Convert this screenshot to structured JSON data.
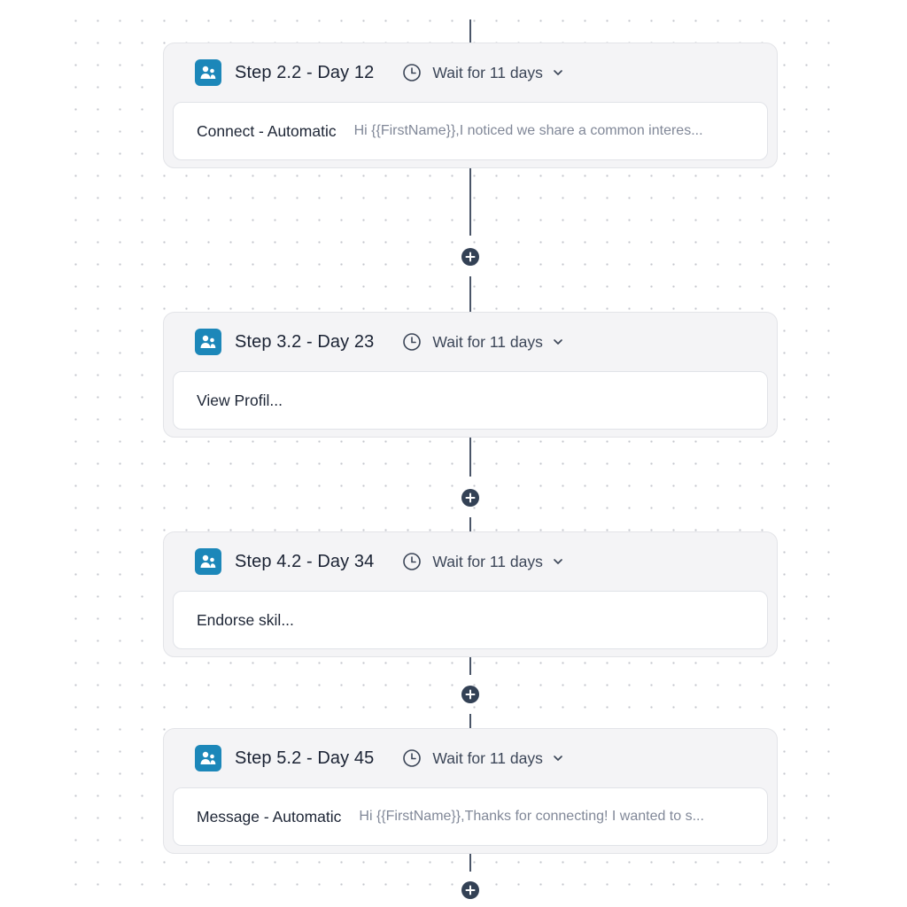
{
  "canvas": {
    "connector_color": "#4a5568",
    "add_button_color": "#334155",
    "step_icon_color": "#1c87b9"
  },
  "steps": [
    {
      "title": "Step 2.2 - Day 12",
      "icon": "people-icon",
      "wait_label": "Wait for 11 days",
      "action": "Connect - Automatic",
      "preview": "Hi {{FirstName}},I noticed we share a common interes..."
    },
    {
      "title": "Step 3.2 - Day 23",
      "icon": "people-icon",
      "wait_label": "Wait for 11 days",
      "action": "View Profil...",
      "preview": ""
    },
    {
      "title": "Step 4.2 - Day 34",
      "icon": "people-icon",
      "wait_label": "Wait for 11 days",
      "action": "Endorse skil...",
      "preview": ""
    },
    {
      "title": "Step 5.2 - Day 45",
      "icon": "people-icon",
      "wait_label": "Wait for 11 days",
      "action": "Message - Automatic",
      "preview": "Hi {{FirstName}},Thanks for connecting! I wanted to s..."
    }
  ],
  "add_step_buttons": [
    {
      "icon": "plus-icon"
    },
    {
      "icon": "plus-icon"
    },
    {
      "icon": "plus-icon"
    },
    {
      "icon": "plus-icon"
    }
  ]
}
